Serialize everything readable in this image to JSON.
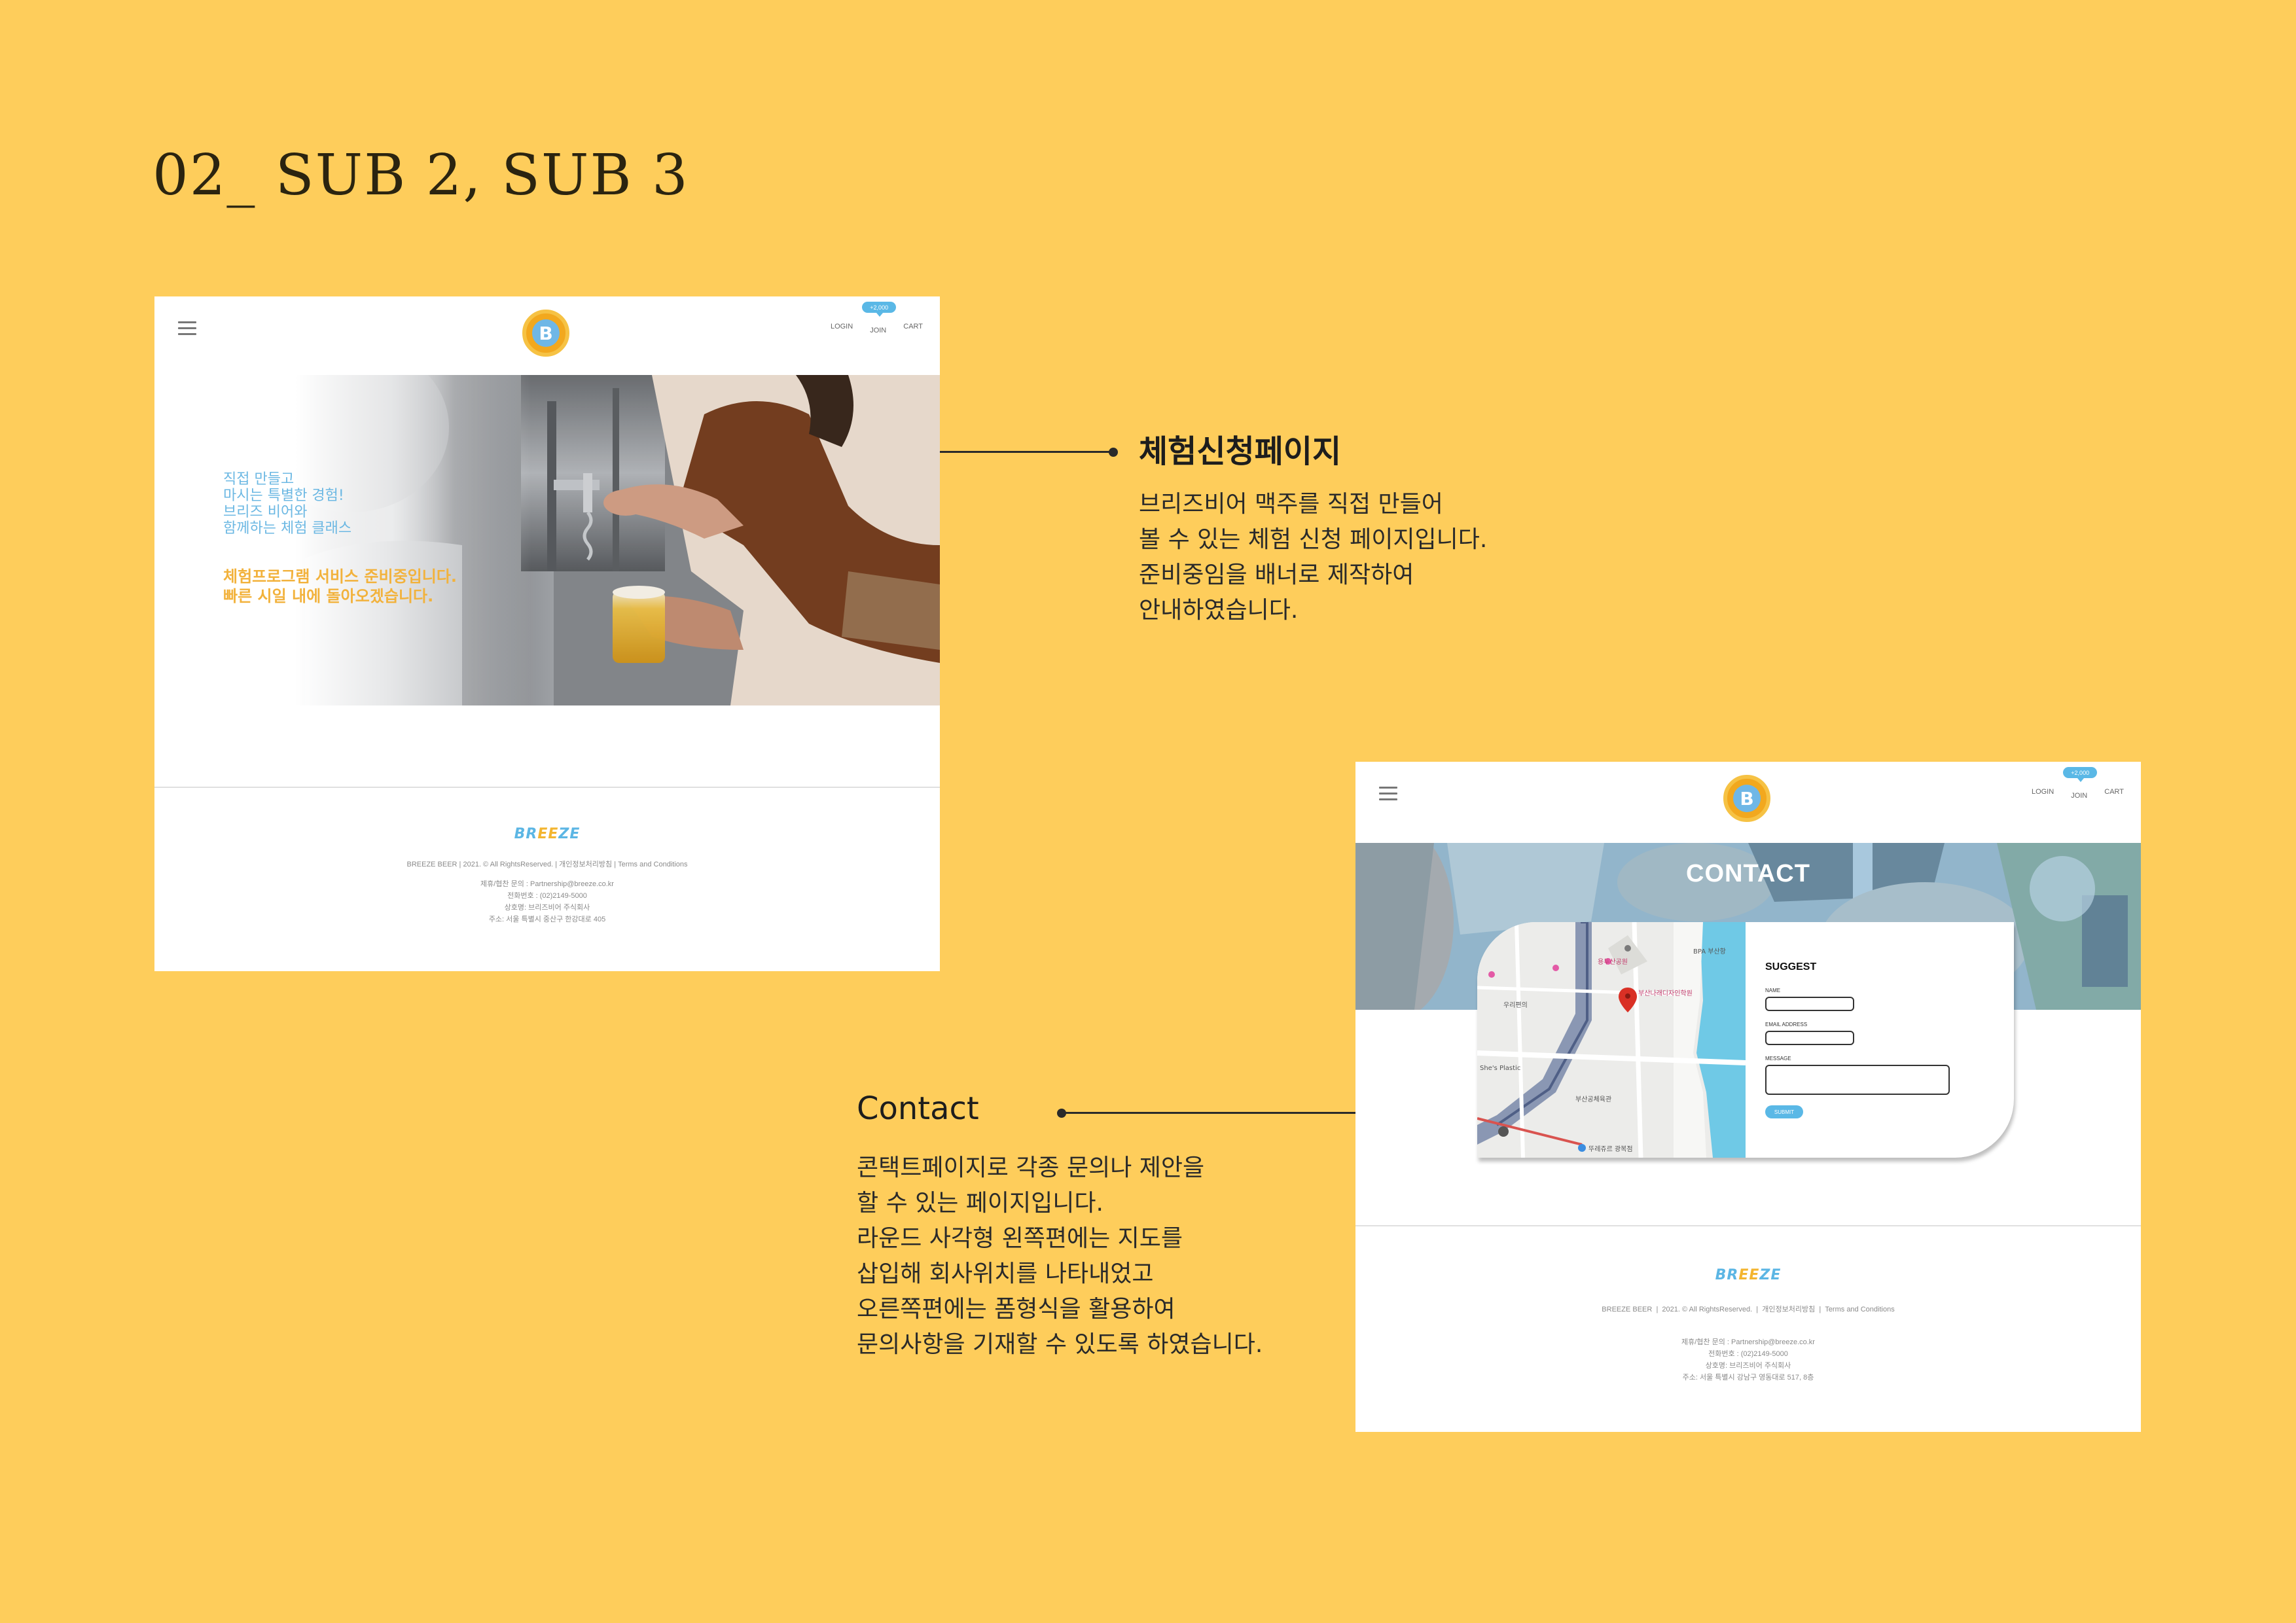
{
  "page_title": "02_ SUB 2, SUB 3",
  "header": {
    "logo_letter": "B",
    "nav": {
      "login": "LOGIN",
      "join": "JOIN",
      "cart": "CART",
      "points_badge": "+2,000"
    }
  },
  "sub2": {
    "banner_lines": [
      "직접 만들고",
      "마시는 특별한 경험!",
      "브리즈 비어와",
      "함께하는 체험 클래스"
    ],
    "notice_lines": [
      "체험프로그램 서비스 준비중입니다.",
      "빠른 시일 내에 돌아오겠습니다."
    ],
    "footer": {
      "logo": {
        "a": "BR",
        "b": "EE",
        "c": "ZE"
      },
      "line1": "BREEZE BEER  |  2021. © All RightsReserved.  |  개인정보처리방침  |  Terms and Conditions",
      "contact_lines": [
        "제휴/협찬 문의 : Partnership@breeze.co.kr",
        "전화번호 : (02)2149-5000",
        "상호명: 브리즈비어 주식회사",
        "주소: 서울 특별시 중산구 한강대로 405"
      ]
    }
  },
  "sub3": {
    "banner_title": "CONTACT",
    "map_labels": [
      "부산나래디자인학원",
      "우리편의",
      "She's Plastic",
      "부산공체육관",
      "뚜레쥬르 광복점",
      "용두산공원",
      "BPA 부산항"
    ],
    "form": {
      "title": "SUGGEST",
      "name_label": "NAME",
      "email_label": "EMAIL ADDRESS",
      "message_label": "MESSAGE",
      "submit_label": "SUBMIT"
    },
    "footer": {
      "logo": {
        "a": "BR",
        "b": "EE",
        "c": "ZE"
      },
      "links": [
        "BREEZE BEER",
        "2021. © All RightsReserved.",
        "개인정보처리방침",
        "Terms and Conditions"
      ],
      "contact_lines": [
        "제휴/협찬 문의 : Partnership@breeze.co.kr",
        "전화번호 : (02)2149-5000",
        "상호명: 브리즈비어 주식회사",
        "주소: 서울 특별시 강남구 영동대로 517, 8층"
      ]
    }
  },
  "annotations": {
    "experience": {
      "heading": "체험신청페이지",
      "lines": [
        "브리즈비어 맥주를 직접 만들어",
        "볼 수 있는 체험 신청 페이지입니다.",
        "준비중임을 배너로 제작하여",
        "안내하였습니다."
      ]
    },
    "contact": {
      "heading": "Contact",
      "lines": [
        "콘택트페이지로 각종 문의나 제안을",
        "할 수 있는 페이지입니다.",
        "라운드 사각형 왼쪽편에는 지도를",
        "삽입해 회사위치를 나타내었고",
        "오른쪽편에는 폼형식을 활용하여",
        "문의사항을 기재할 수 있도록 하였습니다."
      ]
    }
  },
  "colors": {
    "background": "#fecd5b",
    "accent_blue": "#5ab8e6",
    "accent_yellow": "#f2b23c"
  }
}
